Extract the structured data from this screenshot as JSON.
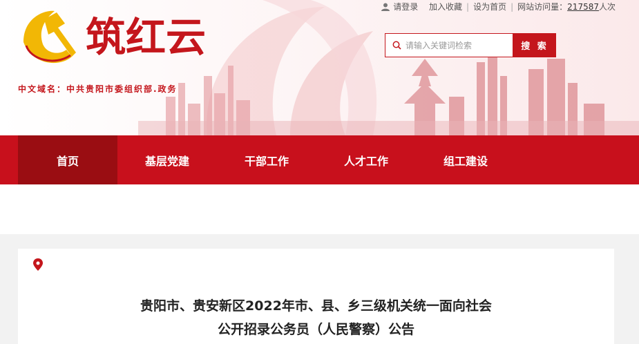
{
  "brand": {
    "logo_text": "筑红云",
    "domain_label": "中文域名：中共贵阳市委组织部.政务"
  },
  "topbar": {
    "login": "请登录",
    "favorite": "加入收藏",
    "homepage": "设为首页",
    "visits_label": "网站访问量：",
    "visits_count": "217587",
    "visits_unit": "人次"
  },
  "search": {
    "placeholder": "请输入关键词检索",
    "button_label": "搜 索"
  },
  "nav": {
    "items": [
      {
        "label": "首页"
      },
      {
        "label": "基层党建"
      },
      {
        "label": "干部工作"
      },
      {
        "label": "人才工作"
      },
      {
        "label": "组工建设"
      }
    ],
    "active_index": 0
  },
  "article": {
    "title_line1": "贵阳市、贵安新区2022年市、县、乡三级机关统一面向社会",
    "title_line2": "公开招录公务员（人民警察）公告"
  },
  "colors": {
    "brand_red": "#c8101c",
    "nav_active": "#9a0d12",
    "emblem_gold": "#f2b705"
  },
  "icons": {
    "user": "user-icon",
    "search": "search-icon",
    "location": "location-pin-icon",
    "emblem": "party-emblem-icon"
  }
}
